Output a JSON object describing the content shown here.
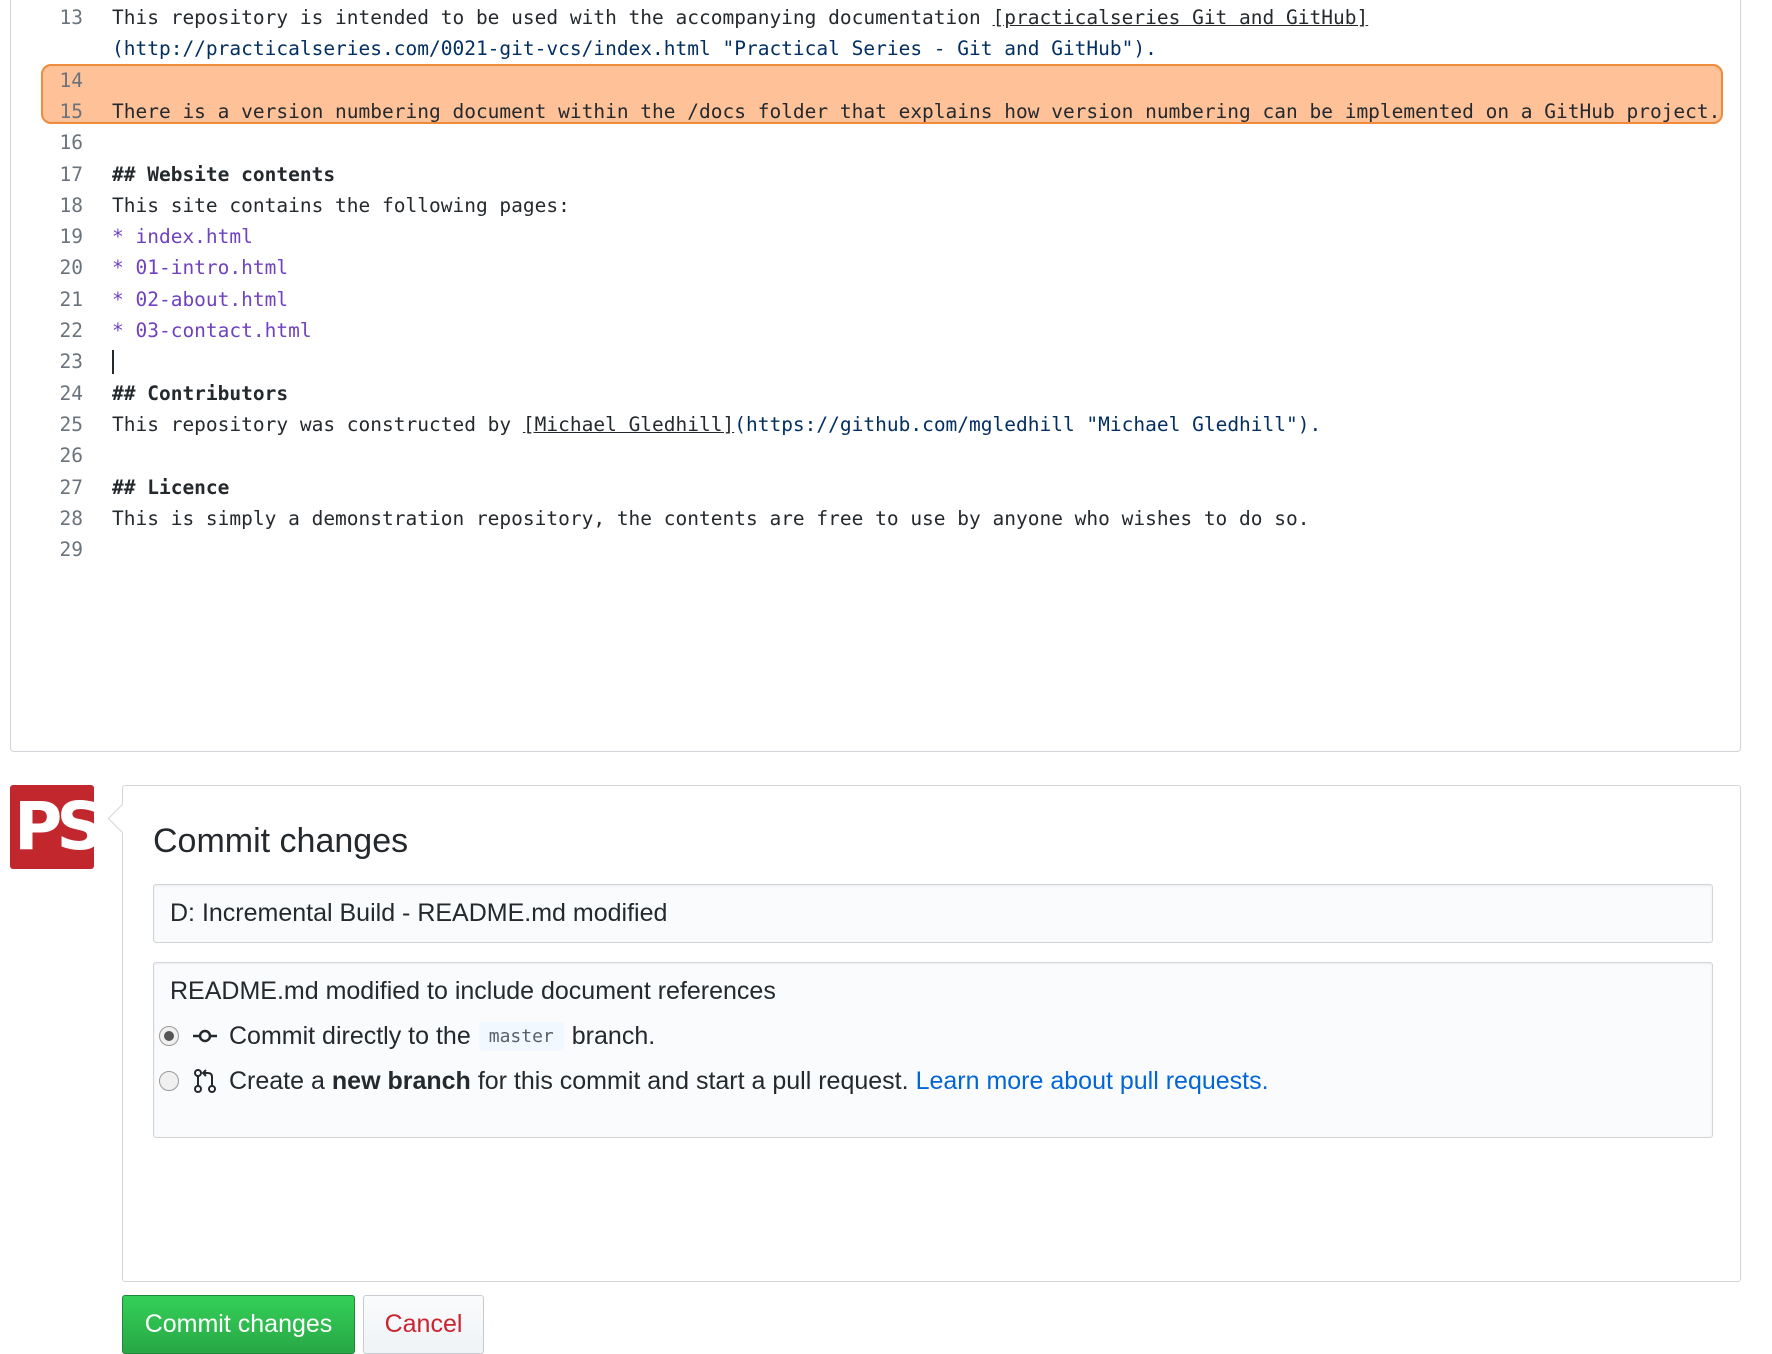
{
  "editor": {
    "lines": [
      {
        "num": "13",
        "segments": [
          {
            "text": "This repository is intended to be used with the accompanying documentation ",
            "style": "plain"
          },
          {
            "text": "[practicalseries Git and GitHub]",
            "style": "link-text"
          }
        ]
      },
      {
        "num": "",
        "segments": [
          {
            "text": "(http://practicalseries.com/0021-git-vcs/index.html \"Practical Series - Git and GitHub\").",
            "style": "url"
          }
        ]
      },
      {
        "num": "14",
        "segments": []
      },
      {
        "num": "15",
        "segments": [
          {
            "text": "There is a version numbering document within the /docs folder that explains how version numbering can be implemented on a GitHub project.",
            "style": "plain"
          }
        ]
      },
      {
        "num": "16",
        "segments": []
      },
      {
        "num": "17",
        "segments": [
          {
            "text": "## Website contents",
            "style": "heading"
          }
        ]
      },
      {
        "num": "18",
        "segments": [
          {
            "text": "This site contains the following pages:",
            "style": "plain"
          }
        ]
      },
      {
        "num": "19",
        "segments": [
          {
            "text": "* index.html",
            "style": "list"
          }
        ]
      },
      {
        "num": "20",
        "segments": [
          {
            "text": "* 01-intro.html",
            "style": "list"
          }
        ]
      },
      {
        "num": "21",
        "segments": [
          {
            "text": "* 02-about.html",
            "style": "list"
          }
        ]
      },
      {
        "num": "22",
        "segments": [
          {
            "text": "* 03-contact.html",
            "style": "list"
          }
        ]
      },
      {
        "num": "23",
        "segments": []
      },
      {
        "num": "24",
        "segments": [
          {
            "text": "## Contributors",
            "style": "heading"
          }
        ]
      },
      {
        "num": "25",
        "segments": [
          {
            "text": "This repository was constructed by ",
            "style": "plain"
          },
          {
            "text": "[Michael Gledhill]",
            "style": "link-text"
          },
          {
            "text": "(https://github.com/mgledhill \"Michael Gledhill\").",
            "style": "url"
          }
        ]
      },
      {
        "num": "26",
        "segments": []
      },
      {
        "num": "27",
        "segments": [
          {
            "text": "## Licence",
            "style": "heading"
          }
        ]
      },
      {
        "num": "28",
        "segments": [
          {
            "text": "This is simply a demonstration repository, the contents are free to use by anyone who wishes to do so.",
            "style": "plain"
          }
        ]
      },
      {
        "num": "29",
        "segments": []
      }
    ],
    "highlighted_lines": [
      "14",
      "15"
    ],
    "cursor_line": "23"
  },
  "avatar": {
    "text": "PS",
    "color": "#c1272d"
  },
  "commit": {
    "title": "Commit changes",
    "summary_value": "D: Incremental Build - README.md modified",
    "description_value": "README.md modified to include document references",
    "option_direct": {
      "prefix": "Commit directly to the",
      "branch": "master",
      "suffix": "branch.",
      "selected": true
    },
    "option_new_branch": {
      "prefix": "Create a",
      "bold": "new branch",
      "suffix": "for this commit and start a pull request.",
      "link": "Learn more about pull requests.",
      "selected": false
    },
    "submit_label": "Commit changes",
    "cancel_label": "Cancel"
  },
  "colors": {
    "highlight_fill": "#ffc197",
    "highlight_border": "#f08a3c",
    "primary_button": "#28a745",
    "cancel_text": "#cb2431",
    "link": "#0366d6"
  }
}
